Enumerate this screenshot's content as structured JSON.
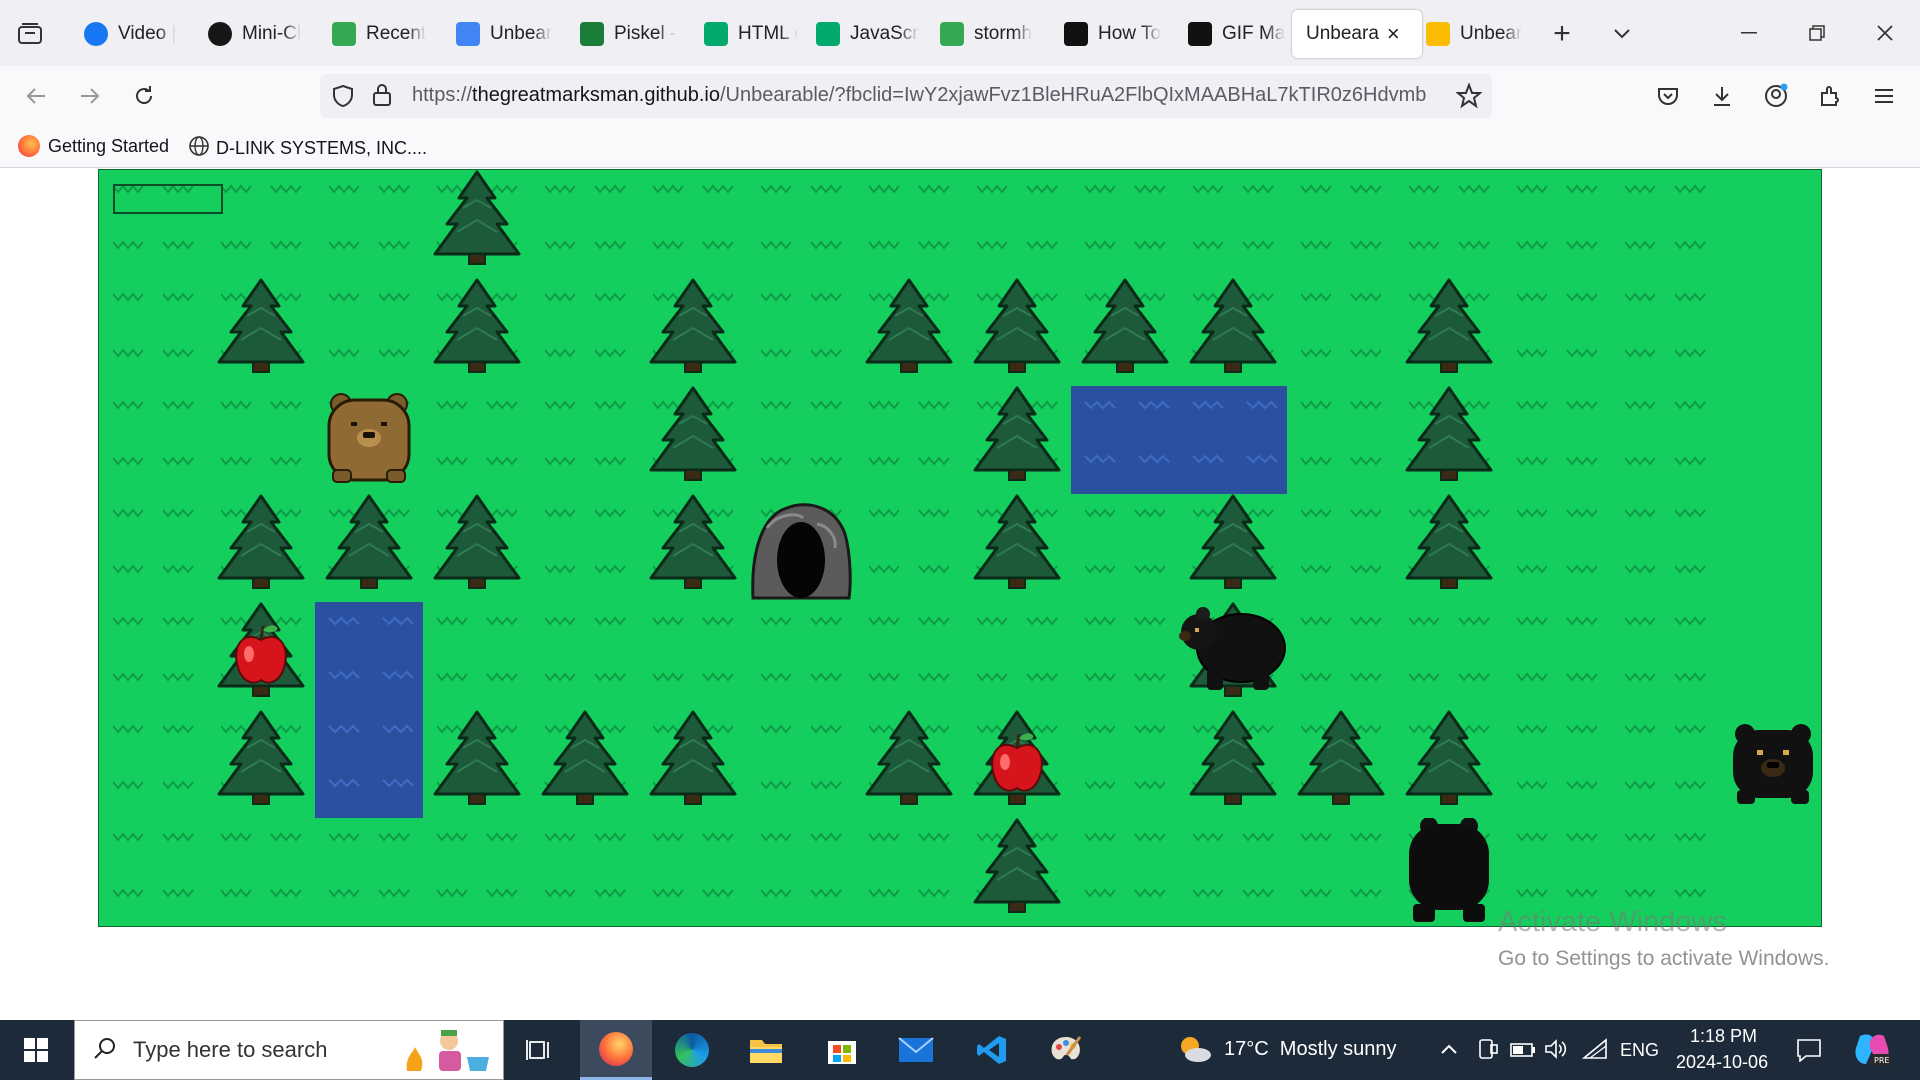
{
  "browser": {
    "tabs": [
      {
        "label": "Video |",
        "icon": "facebook-icon",
        "color": "#1877f2"
      },
      {
        "label": "Mini-Cl",
        "icon": "github-icon",
        "color": "#181717"
      },
      {
        "label": "Recent",
        "icon": "google-drive-icon",
        "color": "#34a853"
      },
      {
        "label": "Unbear",
        "icon": "google-docs-icon",
        "color": "#4285f4"
      },
      {
        "label": "Piskel -",
        "icon": "piskel-icon",
        "color": "#1a7d3a"
      },
      {
        "label": "HTML c",
        "icon": "w3schools-icon",
        "color": "#04aa6d"
      },
      {
        "label": "JavaScr",
        "icon": "w3schools-icon",
        "color": "#04aa6d"
      },
      {
        "label": "stormh",
        "icon": "google-drive-icon",
        "color": "#34a853"
      },
      {
        "label": "How To",
        "icon": "video-site-icon",
        "color": "#111111"
      },
      {
        "label": "GIF Ma",
        "icon": "video-site-icon",
        "color": "#111111"
      },
      {
        "label": "Unbeara",
        "icon": "none",
        "active": true
      },
      {
        "label": "Unbear",
        "icon": "google-slides-icon",
        "color": "#fbbc04"
      }
    ],
    "url": {
      "prefix": "https://",
      "domain": "thegreatmarksman.github.io",
      "rest": "/Unbearable/?fbclid=IwY2xjawFvz1BleHRuA2FlbQIxMAABHaL7kTIR0z6Hdvmb"
    },
    "bookmarks": [
      {
        "label": "Getting Started",
        "icon": "firefox-icon"
      },
      {
        "label": "D-LINK SYSTEMS, INC....",
        "icon": "globe-icon"
      }
    ]
  },
  "game": {
    "health_fraction": 0.0,
    "colors": {
      "grass": "#14cf5e",
      "tree_dark": "#1c5a3a",
      "water": "#2b50a0"
    },
    "trees": [
      [
        3,
        0
      ],
      [
        1,
        1
      ],
      [
        3,
        1
      ],
      [
        5,
        1
      ],
      [
        7,
        1
      ],
      [
        8,
        1
      ],
      [
        9,
        1
      ],
      [
        10,
        1
      ],
      [
        12,
        1
      ],
      [
        5,
        2
      ],
      [
        8,
        2
      ],
      [
        12,
        2
      ],
      [
        1,
        3
      ],
      [
        2,
        3
      ],
      [
        3,
        3
      ],
      [
        5,
        3
      ],
      [
        8,
        3
      ],
      [
        10,
        3
      ],
      [
        12,
        3
      ],
      [
        1,
        4
      ],
      [
        10,
        4
      ],
      [
        1,
        5
      ],
      [
        3,
        5
      ],
      [
        4,
        5
      ],
      [
        5,
        5
      ],
      [
        7,
        5
      ],
      [
        8,
        5
      ],
      [
        10,
        5
      ],
      [
        11,
        5
      ],
      [
        12,
        5
      ],
      [
        8,
        6
      ]
    ],
    "apples": [
      [
        1,
        4
      ],
      [
        8,
        5
      ]
    ],
    "water": [
      {
        "col": 9,
        "row": 2,
        "w": 2,
        "h": 1
      },
      {
        "col": 2,
        "row": 4,
        "w": 1,
        "h": 2
      }
    ],
    "cave": [
      6,
      3
    ],
    "player_bear": {
      "col": 2,
      "row": 2,
      "type": "brown"
    },
    "enemy_bears": [
      {
        "col": 10,
        "row": 4,
        "facing": "left"
      },
      {
        "col": 12,
        "row": 6,
        "facing": "back"
      },
      {
        "col": 15,
        "row": 5,
        "facing": "front"
      }
    ]
  },
  "watermark": {
    "line1": "Activate Windows",
    "line2": "Go to Settings to activate Windows."
  },
  "taskbar": {
    "search_placeholder": "Type here to search",
    "weather": "17°C  Mostly sunny",
    "language": "ENG",
    "time": "1:18 PM",
    "date": "2024-10-06"
  }
}
